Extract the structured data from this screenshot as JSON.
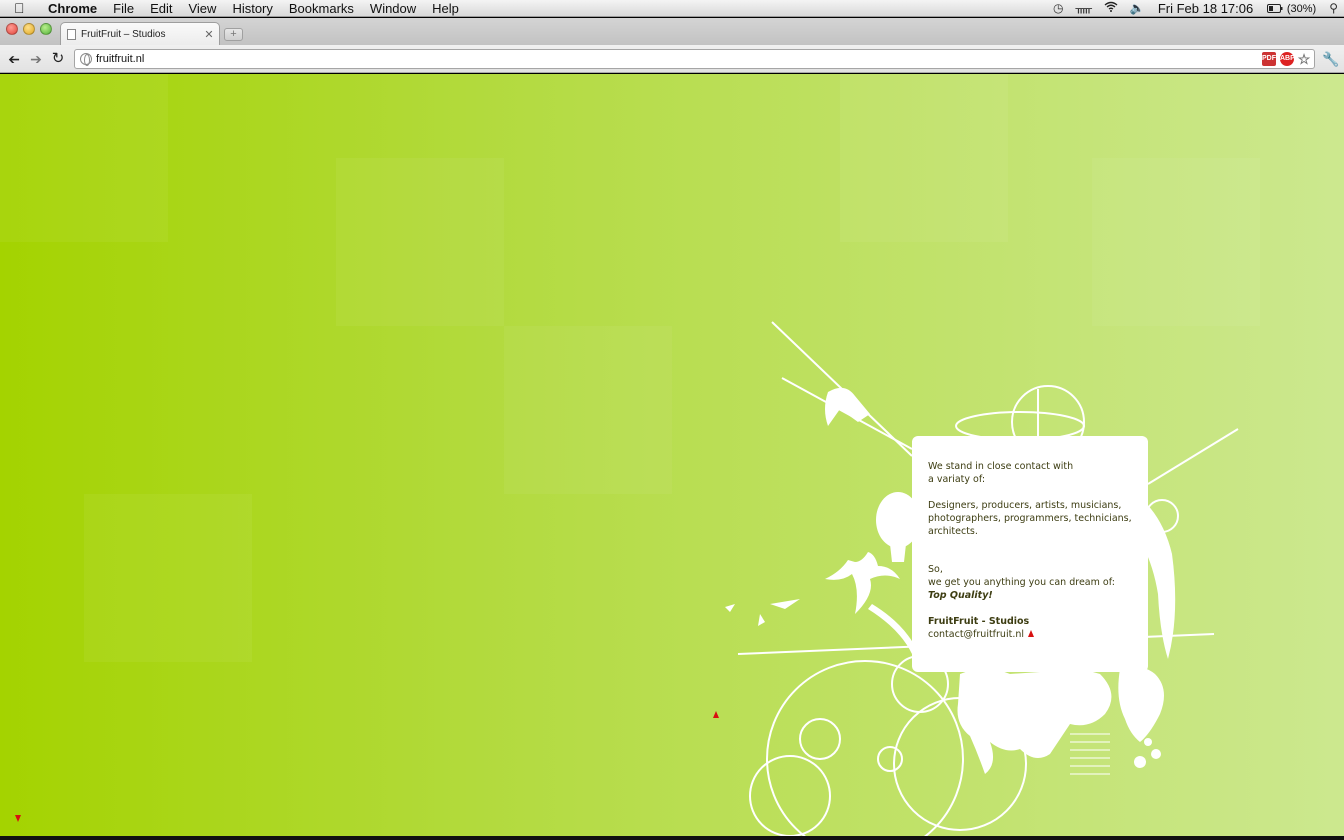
{
  "menubar": {
    "app_name": "Chrome",
    "items": [
      "File",
      "Edit",
      "View",
      "History",
      "Bookmarks",
      "Window",
      "Help"
    ],
    "clock": "Fri Feb 18  17:06",
    "battery": "(30%)"
  },
  "browser": {
    "tab_title": "FruitFruit – Studios",
    "url": "fruitfruit.nl",
    "ext_pdf": "PDF",
    "ext_abp": "ABP"
  },
  "page": {
    "background_start": "#a4d300",
    "background_end": "#cce88f",
    "card": {
      "intro_line1": "We stand in close contact with",
      "intro_line2": "a variaty of:",
      "list_line1": "Designers, producers, artists, musicians,",
      "list_line2": "photographers, programmers, technicians,",
      "list_line3": "architects.",
      "so": "So,",
      "promise": "we get you anything you can dream of:",
      "quality": "Top Quality!",
      "studio_name": "FruitFruit - Studios",
      "email": "contact@fruitfruit.nl"
    }
  }
}
